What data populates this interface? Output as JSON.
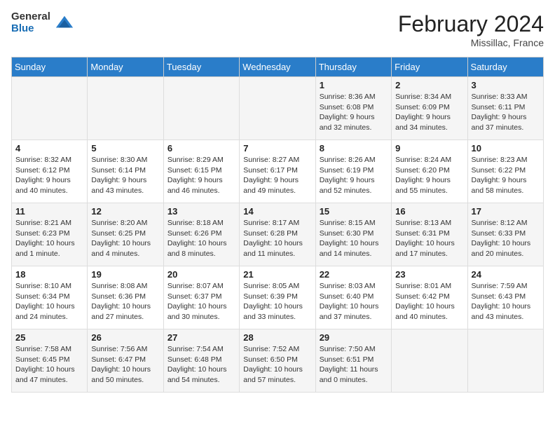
{
  "logo": {
    "line1": "General",
    "line2": "Blue"
  },
  "title": "February 2024",
  "subtitle": "Missillac, France",
  "days_of_week": [
    "Sunday",
    "Monday",
    "Tuesday",
    "Wednesday",
    "Thursday",
    "Friday",
    "Saturday"
  ],
  "weeks": [
    [
      {
        "day": "",
        "info": ""
      },
      {
        "day": "",
        "info": ""
      },
      {
        "day": "",
        "info": ""
      },
      {
        "day": "",
        "info": ""
      },
      {
        "day": "1",
        "info": "Sunrise: 8:36 AM\nSunset: 6:08 PM\nDaylight: 9 hours and 32 minutes."
      },
      {
        "day": "2",
        "info": "Sunrise: 8:34 AM\nSunset: 6:09 PM\nDaylight: 9 hours and 34 minutes."
      },
      {
        "day": "3",
        "info": "Sunrise: 8:33 AM\nSunset: 6:11 PM\nDaylight: 9 hours and 37 minutes."
      }
    ],
    [
      {
        "day": "4",
        "info": "Sunrise: 8:32 AM\nSunset: 6:12 PM\nDaylight: 9 hours and 40 minutes."
      },
      {
        "day": "5",
        "info": "Sunrise: 8:30 AM\nSunset: 6:14 PM\nDaylight: 9 hours and 43 minutes."
      },
      {
        "day": "6",
        "info": "Sunrise: 8:29 AM\nSunset: 6:15 PM\nDaylight: 9 hours and 46 minutes."
      },
      {
        "day": "7",
        "info": "Sunrise: 8:27 AM\nSunset: 6:17 PM\nDaylight: 9 hours and 49 minutes."
      },
      {
        "day": "8",
        "info": "Sunrise: 8:26 AM\nSunset: 6:19 PM\nDaylight: 9 hours and 52 minutes."
      },
      {
        "day": "9",
        "info": "Sunrise: 8:24 AM\nSunset: 6:20 PM\nDaylight: 9 hours and 55 minutes."
      },
      {
        "day": "10",
        "info": "Sunrise: 8:23 AM\nSunset: 6:22 PM\nDaylight: 9 hours and 58 minutes."
      }
    ],
    [
      {
        "day": "11",
        "info": "Sunrise: 8:21 AM\nSunset: 6:23 PM\nDaylight: 10 hours and 1 minute."
      },
      {
        "day": "12",
        "info": "Sunrise: 8:20 AM\nSunset: 6:25 PM\nDaylight: 10 hours and 4 minutes."
      },
      {
        "day": "13",
        "info": "Sunrise: 8:18 AM\nSunset: 6:26 PM\nDaylight: 10 hours and 8 minutes."
      },
      {
        "day": "14",
        "info": "Sunrise: 8:17 AM\nSunset: 6:28 PM\nDaylight: 10 hours and 11 minutes."
      },
      {
        "day": "15",
        "info": "Sunrise: 8:15 AM\nSunset: 6:30 PM\nDaylight: 10 hours and 14 minutes."
      },
      {
        "day": "16",
        "info": "Sunrise: 8:13 AM\nSunset: 6:31 PM\nDaylight: 10 hours and 17 minutes."
      },
      {
        "day": "17",
        "info": "Sunrise: 8:12 AM\nSunset: 6:33 PM\nDaylight: 10 hours and 20 minutes."
      }
    ],
    [
      {
        "day": "18",
        "info": "Sunrise: 8:10 AM\nSunset: 6:34 PM\nDaylight: 10 hours and 24 minutes."
      },
      {
        "day": "19",
        "info": "Sunrise: 8:08 AM\nSunset: 6:36 PM\nDaylight: 10 hours and 27 minutes."
      },
      {
        "day": "20",
        "info": "Sunrise: 8:07 AM\nSunset: 6:37 PM\nDaylight: 10 hours and 30 minutes."
      },
      {
        "day": "21",
        "info": "Sunrise: 8:05 AM\nSunset: 6:39 PM\nDaylight: 10 hours and 33 minutes."
      },
      {
        "day": "22",
        "info": "Sunrise: 8:03 AM\nSunset: 6:40 PM\nDaylight: 10 hours and 37 minutes."
      },
      {
        "day": "23",
        "info": "Sunrise: 8:01 AM\nSunset: 6:42 PM\nDaylight: 10 hours and 40 minutes."
      },
      {
        "day": "24",
        "info": "Sunrise: 7:59 AM\nSunset: 6:43 PM\nDaylight: 10 hours and 43 minutes."
      }
    ],
    [
      {
        "day": "25",
        "info": "Sunrise: 7:58 AM\nSunset: 6:45 PM\nDaylight: 10 hours and 47 minutes."
      },
      {
        "day": "26",
        "info": "Sunrise: 7:56 AM\nSunset: 6:47 PM\nDaylight: 10 hours and 50 minutes."
      },
      {
        "day": "27",
        "info": "Sunrise: 7:54 AM\nSunset: 6:48 PM\nDaylight: 10 hours and 54 minutes."
      },
      {
        "day": "28",
        "info": "Sunrise: 7:52 AM\nSunset: 6:50 PM\nDaylight: 10 hours and 57 minutes."
      },
      {
        "day": "29",
        "info": "Sunrise: 7:50 AM\nSunset: 6:51 PM\nDaylight: 11 hours and 0 minutes."
      },
      {
        "day": "",
        "info": ""
      },
      {
        "day": "",
        "info": ""
      }
    ]
  ]
}
